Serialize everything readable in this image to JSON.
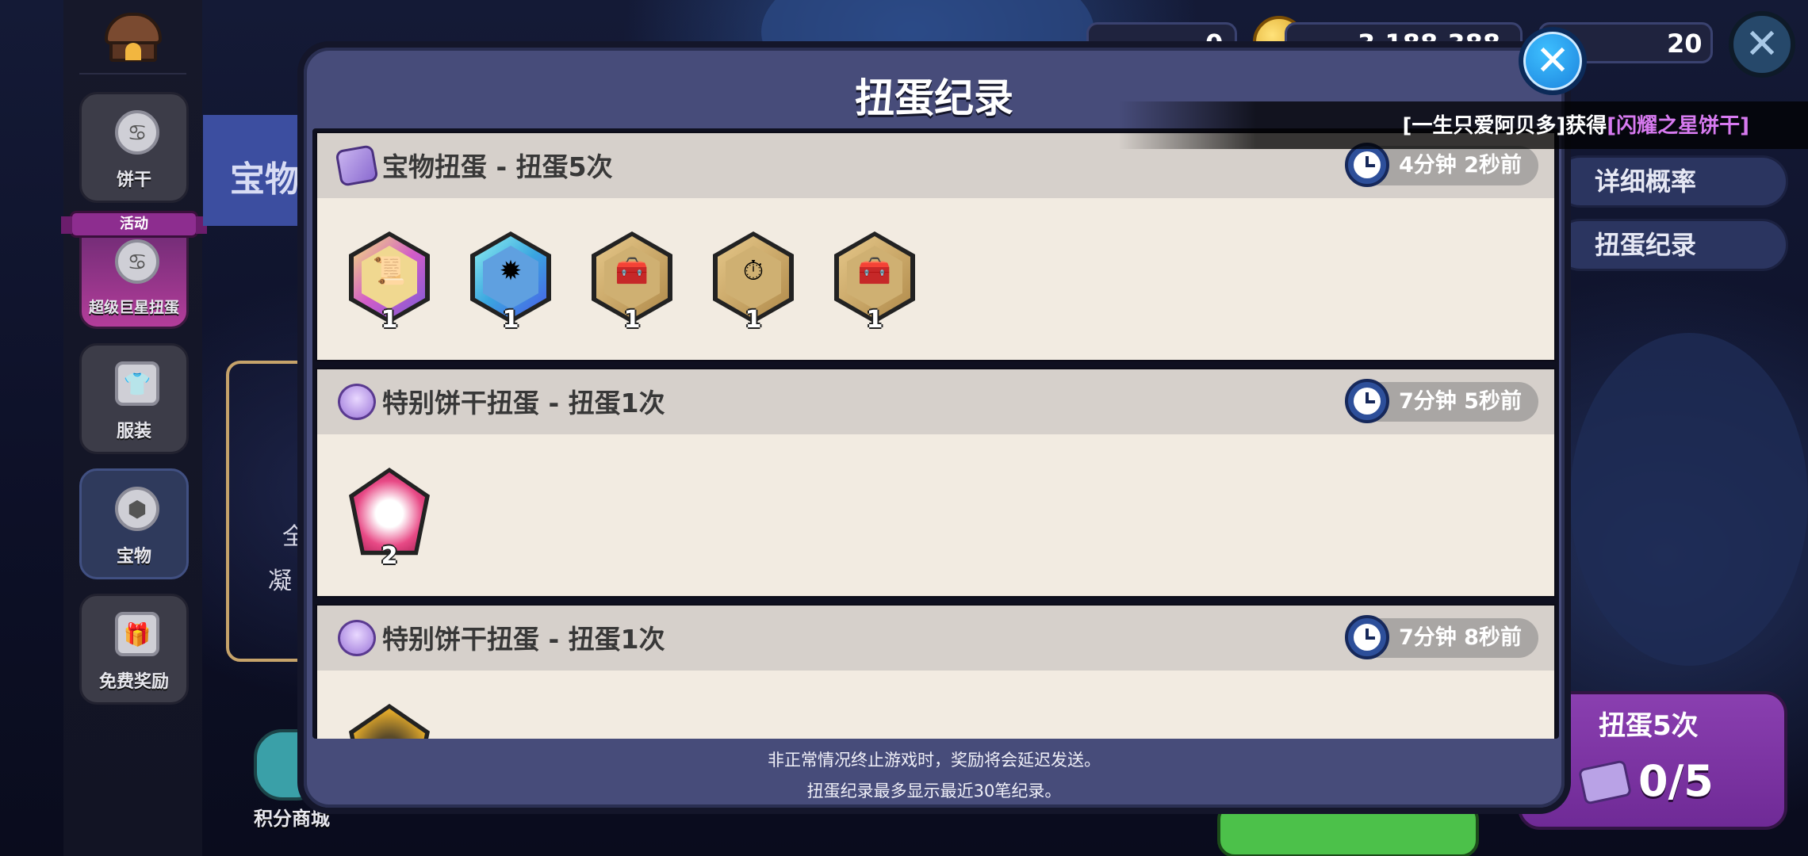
{
  "sidebar": {
    "items": [
      {
        "label": "饼干",
        "icon": "cookie-icon"
      },
      {
        "label": "超级巨星扭蛋",
        "icon": "cookie-icon",
        "tag": "活动"
      },
      {
        "label": "服装",
        "icon": "shirt-icon"
      },
      {
        "label": "宝物",
        "icon": "hexagon-icon"
      },
      {
        "label": "免费奖励",
        "icon": "gift-icon"
      }
    ]
  },
  "background": {
    "panel_title": "宝物",
    "frame_text_1": "全",
    "frame_text_2": "凝",
    "shop_label": "积分商城"
  },
  "top_bar": {
    "currency_1": "0",
    "currency_2": "3,188,388",
    "currency_3": "20"
  },
  "announcement": {
    "player": "[一生只爱阿贝多]获得",
    "reward": "[闪耀之星饼干]"
  },
  "right_menu": {
    "rates_label": "详细概率",
    "history_label": "扭蛋纪录"
  },
  "pull_button": {
    "title": "扭蛋5次",
    "count": "0/5"
  },
  "dialog": {
    "title": "扭蛋纪录",
    "footer_line_1": "非正常情况终止游戏时，奖励将会延迟发送。",
    "footer_line_2": "扭蛋纪录最多显示最近30笔纪录。",
    "records": [
      {
        "title": "宝物扭蛋 - 扭蛋5次",
        "time": "4分钟 2秒前",
        "items": [
          {
            "count": "1",
            "icon": "scroll-treasure-icon",
            "frame": "#d25cc8"
          },
          {
            "count": "1",
            "icon": "dark-crystal-treasure-icon",
            "frame": "#3aa6e0"
          },
          {
            "count": "1",
            "icon": "treasure-chest-icon",
            "frame": "#c8a45a"
          },
          {
            "count": "1",
            "icon": "pocket-watch-icon",
            "frame": "#c8a45a"
          },
          {
            "count": "1",
            "icon": "treasure-chest-icon",
            "frame": "#c8a45a"
          }
        ]
      },
      {
        "title": "特别饼干扭蛋 - 扭蛋1次",
        "time": "7分钟 5秒前",
        "items": [
          {
            "count": "2",
            "icon": "white-lily-soulstone-icon",
            "frame": "#d2245e"
          }
        ]
      },
      {
        "title": "特别饼干扭蛋 - 扭蛋1次",
        "time": "7分钟 8秒前",
        "items": [
          {
            "count": "",
            "icon": "gold-soulstone-icon",
            "frame": "#e0a82a"
          }
        ]
      }
    ]
  }
}
